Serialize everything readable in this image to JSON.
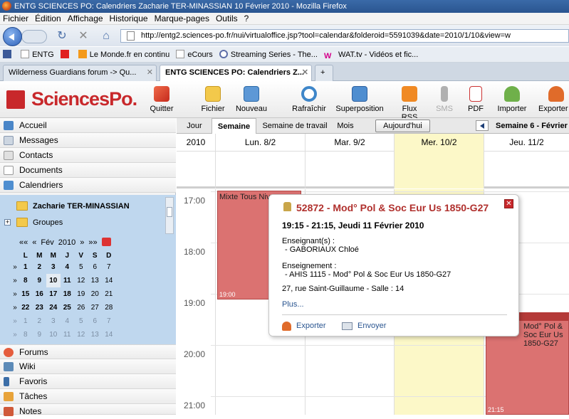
{
  "window": {
    "title": "ENTG SCIENCES PO: Calendriers Zacharie TER-MINASSIAN 10 Février 2010 - Mozilla Firefox"
  },
  "menu": [
    "Fichier",
    "Édition",
    "Affichage",
    "Historique",
    "Marque-pages",
    "Outils",
    "?"
  ],
  "url": "http://entg2.sciences-po.fr/nui/virtualoffice.jsp?tool=calendar&folderoid=5591039&date=2010/1/10&view=w",
  "bookmarks": [
    "ENTG",
    "Le Monde.fr en continu",
    "eCours",
    "Streaming Series - The...",
    "WAT.tv - Vidéos et fic..."
  ],
  "browser_tabs": [
    {
      "label": "Wilderness Guardians forum -> Qu...",
      "active": false
    },
    {
      "label": "ENTG SCIENCES PO: Calendriers Z...",
      "active": true
    }
  ],
  "logo": "SciencesPo.",
  "toolbar": {
    "quitter": "Quitter",
    "fichier": "Fichier",
    "nouveau": "Nouveau",
    "rafraichir": "Rafraîchir",
    "superposition": "Superposition",
    "flux_rss": "Flux RSS",
    "sms": "SMS",
    "pdf": "PDF",
    "importer": "Importer",
    "exporter": "Exporter"
  },
  "sidebar": {
    "items_top": [
      "Accueil",
      "Messages",
      "Contacts",
      "Documents",
      "Calendriers"
    ],
    "folders": [
      "Zacharie TER-MINASSIAN",
      "Groupes"
    ],
    "items_bottom": [
      "Forums",
      "Wiki",
      "Favoris",
      "Tâches",
      "Notes"
    ]
  },
  "minical": {
    "nav": {
      "first": "««",
      "prev": "«",
      "month": "Fév",
      "year": "2010",
      "next": "»",
      "last": "»»"
    },
    "weekdays": [
      "L",
      "M",
      "M",
      "J",
      "V",
      "S",
      "D"
    ],
    "week_marker": "»",
    "weeks": [
      [
        "1",
        "2",
        "3",
        "4",
        "5",
        "6",
        "7"
      ],
      [
        "8",
        "9",
        "10",
        "11",
        "12",
        "13",
        "14"
      ],
      [
        "15",
        "16",
        "17",
        "18",
        "19",
        "20",
        "21"
      ],
      [
        "22",
        "23",
        "24",
        "25",
        "26",
        "27",
        "28"
      ],
      [
        "1",
        "2",
        "3",
        "4",
        "5",
        "6",
        "7"
      ],
      [
        "8",
        "9",
        "10",
        "11",
        "12",
        "13",
        "14"
      ]
    ]
  },
  "calendar": {
    "views": [
      "Jour",
      "Semaine",
      "Semaine de travail",
      "Mois"
    ],
    "active_view": "Semaine",
    "today_button": "Aujourd'hui",
    "week_label": "Semaine 6 - Février",
    "year": "2010",
    "days": [
      "Lun. 8/2",
      "Mar. 9/2",
      "Mer. 10/2",
      "Jeu. 11/2"
    ],
    "hours": [
      "17:00",
      "18:00",
      "19:00",
      "20:00",
      "21:00"
    ],
    "events": [
      {
        "title": "Mixte Tous Niv",
        "end_label": "19:00"
      },
      {
        "title": "Mod° Pol & Soc Eur Us 1850-G27",
        "end_label": "21:15"
      }
    ]
  },
  "popup": {
    "title": "52872 - Mod° Pol & Soc Eur Us 1850-G27",
    "time": "19:15 - 21:15, Jeudi 11 Février 2010",
    "teacher_label": "Enseignant(s) :",
    "teacher": "- GABORIAUX Chloé",
    "course_label": "Enseignement :",
    "course": "- AHIS 1115 - Mod° Pol & Soc Eur Us 1850-G27",
    "location": "27, rue Saint-Guillaume - Salle : 14",
    "more": "Plus...",
    "export": "Exporter",
    "send": "Envoyer"
  },
  "colors": {
    "brand": "#c8282b",
    "event": "#db7271",
    "today_col": "#fcf8c8",
    "selection": "#bfd7ee"
  }
}
